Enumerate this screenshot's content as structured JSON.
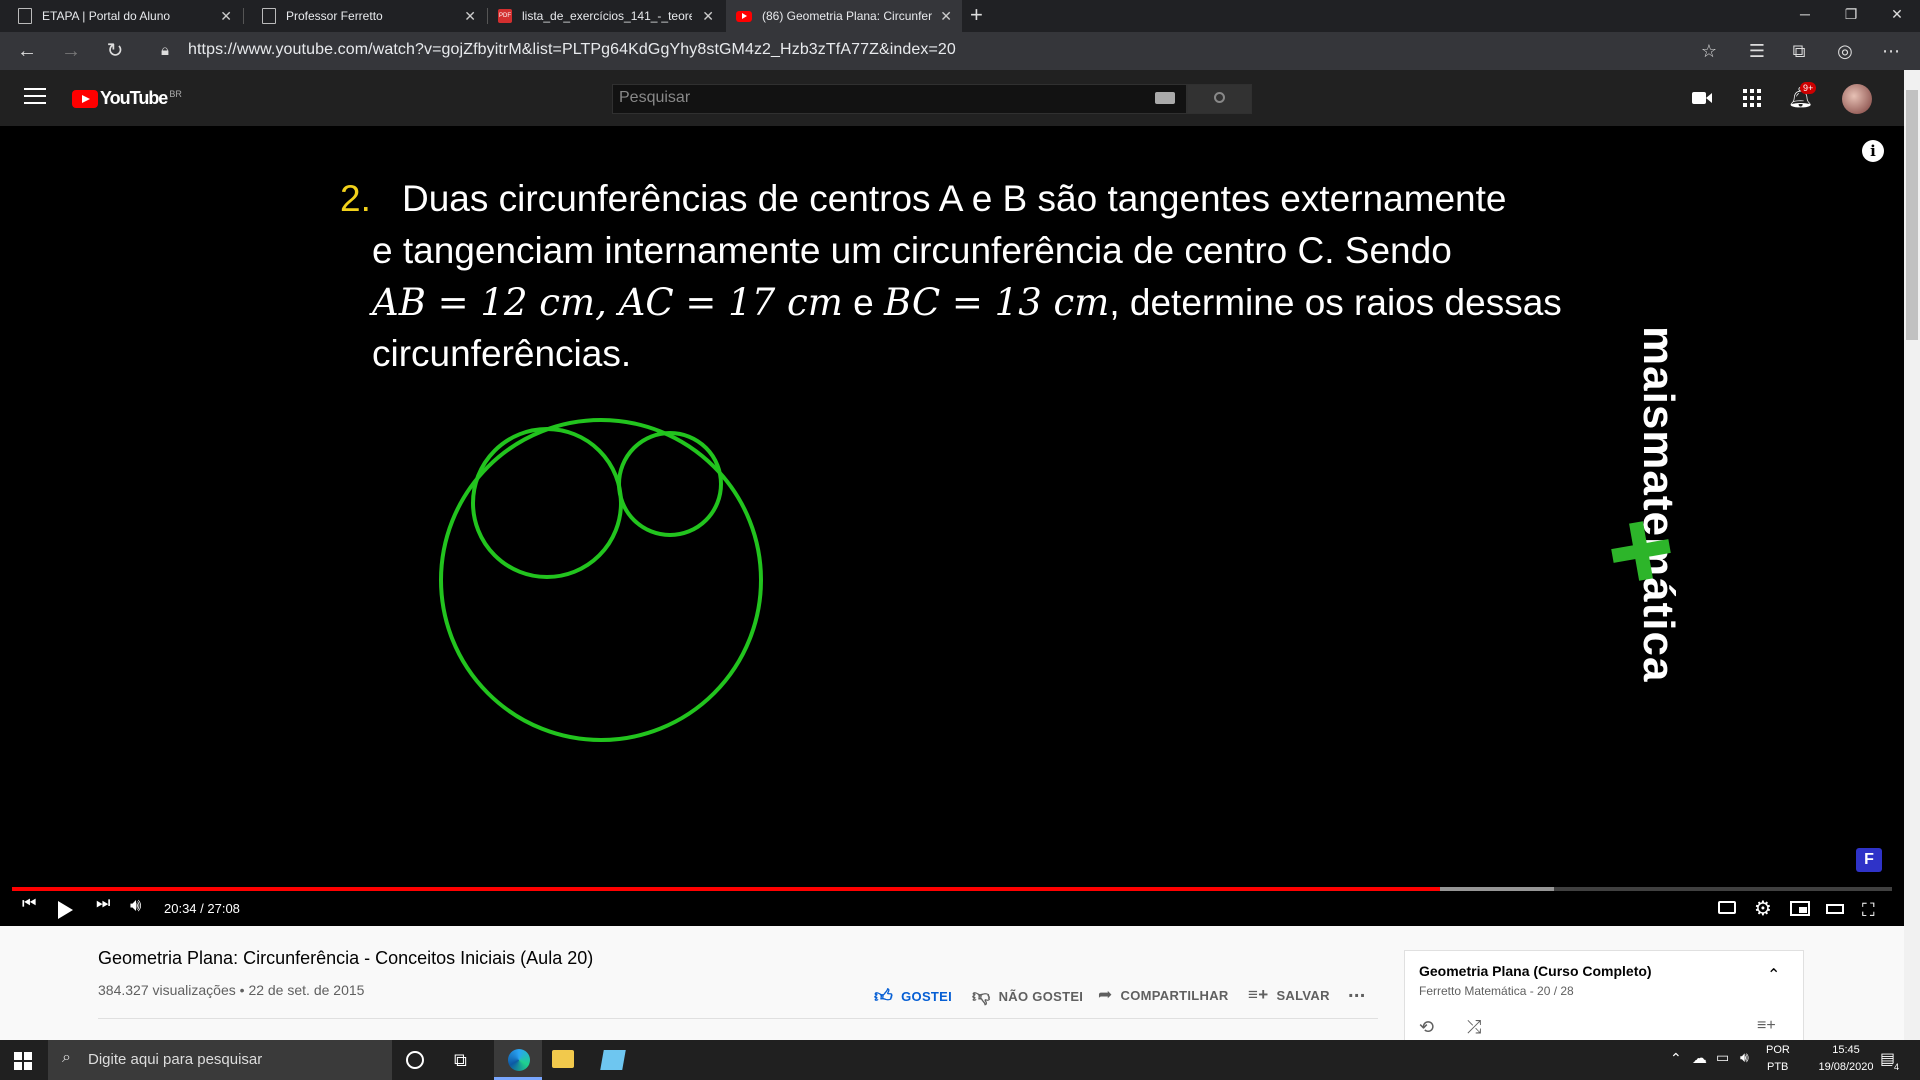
{
  "browser": {
    "tabs": [
      {
        "title": "ETAPA | Portal do Aluno",
        "active": false
      },
      {
        "title": "Professor Ferretto",
        "active": false
      },
      {
        "title": "lista_de_exercícios_141_-_teorem",
        "active": false
      },
      {
        "title": "(86) Geometria Plana: Circunferê",
        "active": true
      }
    ],
    "new_tab": "+",
    "url": "https://www.youtube.com/watch?v=gojZfbyitrM&list=PLTPg64KdGgYhy8stGM4z2_Hzb3zTfA77Z&index=20"
  },
  "youtube": {
    "logo_text": "YouTube",
    "logo_region": "BR",
    "search_placeholder": "Pesquisar",
    "notif_count": "9+"
  },
  "video": {
    "question_number": "2.",
    "lines": [
      "Duas circunferências de centros A e B são tangentes externamente",
      "e tangenciam internamente um circunferência de centro C. Sendo",
      ", determine os raios dessas",
      "circunferências."
    ],
    "math_expr": "AB = 12 cm, AC = 17 cm",
    "math_e": " e ",
    "math_expr2": "BC = 13 cm",
    "watermark": "maismatemática",
    "time": "20:34 / 27:08",
    "progress_fraction": 0.7594,
    "buffer_fraction": 0.82
  },
  "info": {
    "title": "Geometria Plana: Circunferência - Conceitos Iniciais (Aula 20)",
    "meta": "384.327 visualizações • 22 de set. de 2015",
    "like": "GOSTEI",
    "dislike": "NÃO GOSTEI",
    "share": "COMPARTILHAR",
    "save": "SALVAR",
    "more": "..."
  },
  "playlist": {
    "title": "Geometria Plana (Curso Completo)",
    "subtitle": "Ferretto Matemática - 20 / 28"
  },
  "taskbar": {
    "search_placeholder": "Digite aqui para pesquisar",
    "lang_top": "POR",
    "lang_bottom": "PTB",
    "time": "15:45",
    "date": "19/08/2020",
    "notif_count": "4"
  },
  "colors": {
    "circle": "#22c41e",
    "number": "#f2d11b",
    "progress": "#ff0000",
    "like_blue": "#065fd4",
    "yt_red": "#ff0000"
  }
}
